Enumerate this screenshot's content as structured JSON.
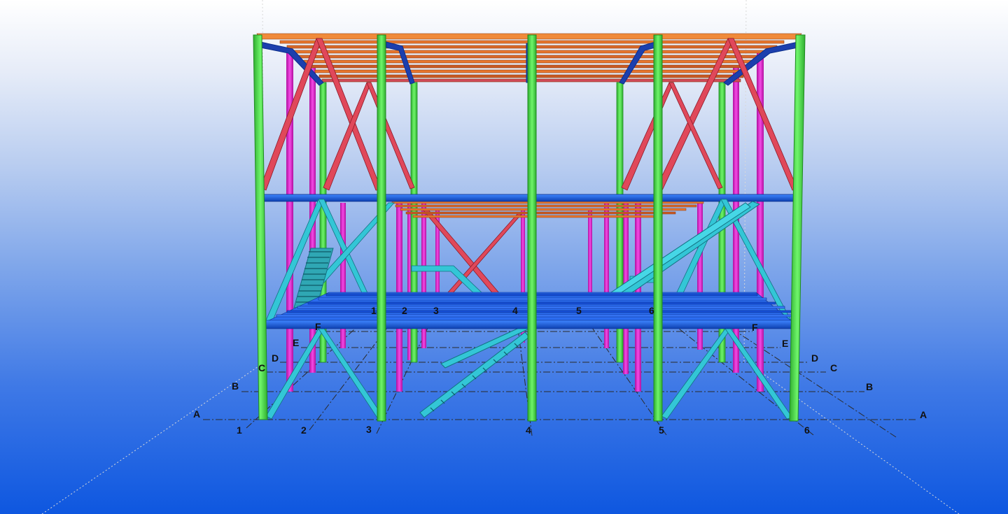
{
  "viewport": {
    "background_top": "#ffffff",
    "background_bottom": "#0e57e0"
  },
  "member_colors": {
    "columns": "#49e84a",
    "column_edge": "#1f8a22",
    "secondary_columns": "#e61fd6",
    "roof_beams": "#e8772e",
    "roof_edge": "#8a3a12",
    "cross_bracing": "#e0485a",
    "floor_beams": "#1a62f2",
    "floor_edge": "#0b2f8c",
    "knee_braces": "#1c3fae",
    "stairs_and_braces": "#33c6d6",
    "stairs_edge": "#137282",
    "gridlines": "#222222"
  },
  "grid_labels": {
    "numbers_front": [
      "1",
      "2",
      "3",
      "4",
      "5",
      "6"
    ],
    "numbers_mid": [
      "1",
      "2",
      "3",
      "4",
      "5",
      "6"
    ],
    "letters_left": [
      "A",
      "B",
      "C",
      "D",
      "E",
      "F"
    ],
    "letters_right": [
      "A",
      "B",
      "C",
      "D",
      "E",
      "F"
    ]
  }
}
